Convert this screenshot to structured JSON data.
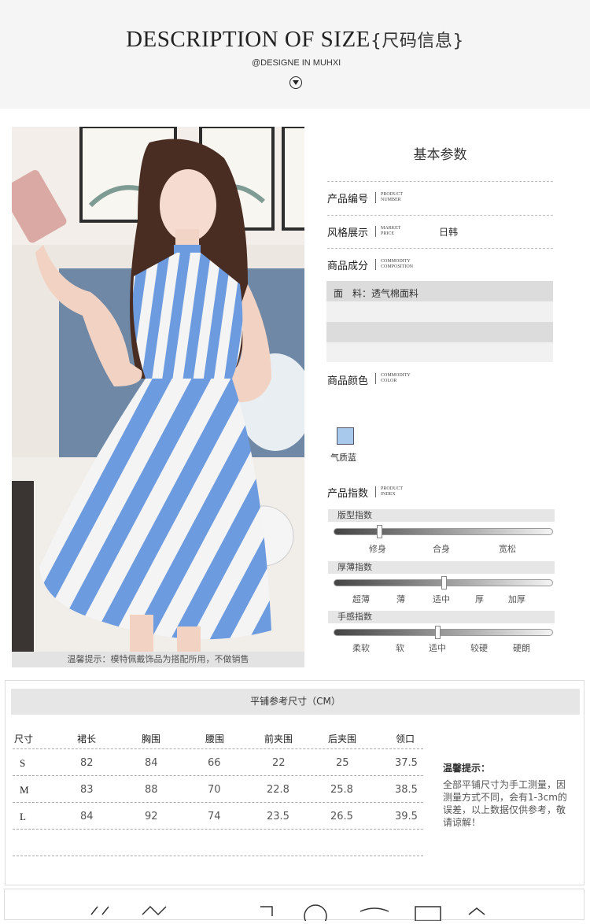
{
  "header": {
    "title": "DESCRIPTION OF SIZE",
    "title_cn": "{尺码信息}",
    "subtitle": "@DESIGNE IN MUHXI"
  },
  "photo": {
    "note": "温馨提示：模特佩戴饰品为搭配所用，不做销售",
    "dress_colors": [
      "#6d9be0",
      "#f4f4f4"
    ]
  },
  "params": {
    "title": "基本参数",
    "product_number": {
      "label": "产品编号",
      "en": [
        "PRODUCT",
        "NUMBER"
      ]
    },
    "style": {
      "label": "风格展示",
      "en": [
        "MARKET",
        "PRICE"
      ],
      "value": "日韩"
    },
    "composition": {
      "label": "商品成分",
      "en": [
        "COMMODITY",
        "COMPOSITION"
      ]
    },
    "fabric": "面　料：透气棉面料",
    "color": {
      "label": "商品颜色",
      "en": [
        "COMMODITY",
        "COLOR"
      ],
      "swatch": "#a8c9ec",
      "name": "气质蓝"
    },
    "index": {
      "label": "产品指数",
      "en": [
        "PRODUCT",
        "INDEX"
      ]
    },
    "sliders": [
      {
        "title": "版型指数",
        "ticks": [
          "修身",
          "合身",
          "宽松"
        ],
        "value": 0.2
      },
      {
        "title": "厚薄指数",
        "ticks": [
          "超薄",
          "薄",
          "适中",
          "厚",
          "加厚"
        ],
        "value": 0.5
      },
      {
        "title": "手感指数",
        "ticks": [
          "柔软",
          "软",
          "适中",
          "较硬",
          "硬朗"
        ],
        "value": 0.47
      }
    ]
  },
  "size_table": {
    "title": "平铺参考尺寸（CM）",
    "headers": [
      "尺寸",
      "裙长",
      "胸围",
      "腰围",
      "前夹围",
      "后夹围",
      "领口"
    ],
    "rows": [
      [
        "S",
        "82",
        "84",
        "66",
        "22",
        "25",
        "37.5"
      ],
      [
        "M",
        "83",
        "88",
        "70",
        "22.8",
        "25.8",
        "38.5"
      ],
      [
        "L",
        "84",
        "92",
        "74",
        "23.5",
        "26.5",
        "39.5"
      ]
    ],
    "tip_title": "温馨提示：",
    "tip_text": "全部平铺尺寸为手工测量，因测量方式不同，会有1-3cm的误差，以上数据仅供参考，敬请谅解！"
  }
}
